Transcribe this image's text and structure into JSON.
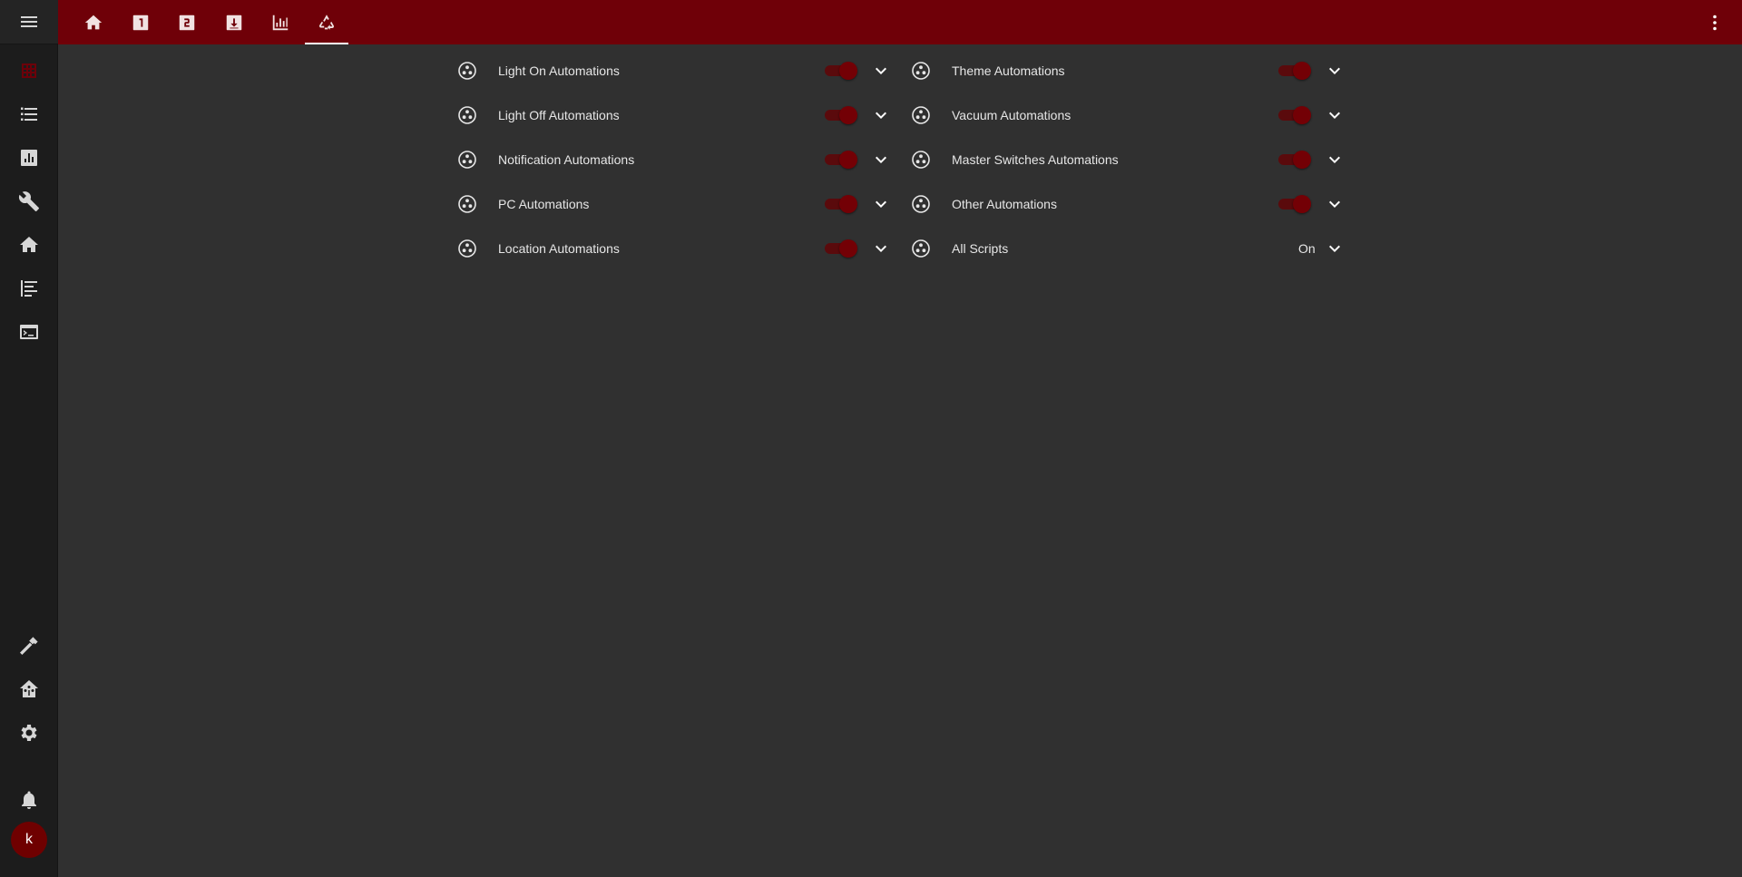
{
  "sidebar": {
    "menu_icon": "menu-icon",
    "items": [
      {
        "name": "overview",
        "icon": "dashboard-grid-icon",
        "active": true
      },
      {
        "name": "list",
        "icon": "format-list-bulleted-icon"
      },
      {
        "name": "history",
        "icon": "chart-box-icon"
      },
      {
        "name": "wrench",
        "icon": "wrench-icon"
      },
      {
        "name": "home",
        "icon": "home-icon"
      },
      {
        "name": "logbook",
        "icon": "format-list-bars-icon"
      },
      {
        "name": "terminal",
        "icon": "console-icon"
      }
    ],
    "bottom_items": [
      {
        "name": "developer-tools",
        "icon": "hammer-icon"
      },
      {
        "name": "supervisor",
        "icon": "home-assistant-icon"
      },
      {
        "name": "settings",
        "icon": "gear-icon"
      },
      {
        "name": "notifications",
        "icon": "bell-icon"
      }
    ],
    "avatar_letter": "k"
  },
  "header": {
    "tabs": [
      {
        "icon": "home-icon"
      },
      {
        "icon": "numeric-1-box-icon"
      },
      {
        "icon": "numeric-2-box-icon"
      },
      {
        "icon": "download-box-icon"
      },
      {
        "icon": "chart-bar-icon"
      },
      {
        "icon": "recycle-icon",
        "active": true
      }
    ],
    "overflow_icon": "dots-vertical-icon"
  },
  "colors": {
    "accent": "#6f0008",
    "background": "#303030",
    "sidebar": "#1c1c1c"
  },
  "rows_left": [
    {
      "label": "Light On Automations",
      "state": "on"
    },
    {
      "label": "Light Off Automations",
      "state": "on"
    },
    {
      "label": "Notification Automations",
      "state": "on"
    },
    {
      "label": "PC Automations",
      "state": "on"
    },
    {
      "label": "Location Automations",
      "state": "on"
    }
  ],
  "rows_right": [
    {
      "label": "Theme Automations",
      "state": "on"
    },
    {
      "label": "Vacuum Automations",
      "state": "on"
    },
    {
      "label": "Master Switches Automations",
      "state": "on"
    },
    {
      "label": "Other Automations",
      "state": "on"
    },
    {
      "label": "All Scripts",
      "state_text": "On"
    }
  ]
}
